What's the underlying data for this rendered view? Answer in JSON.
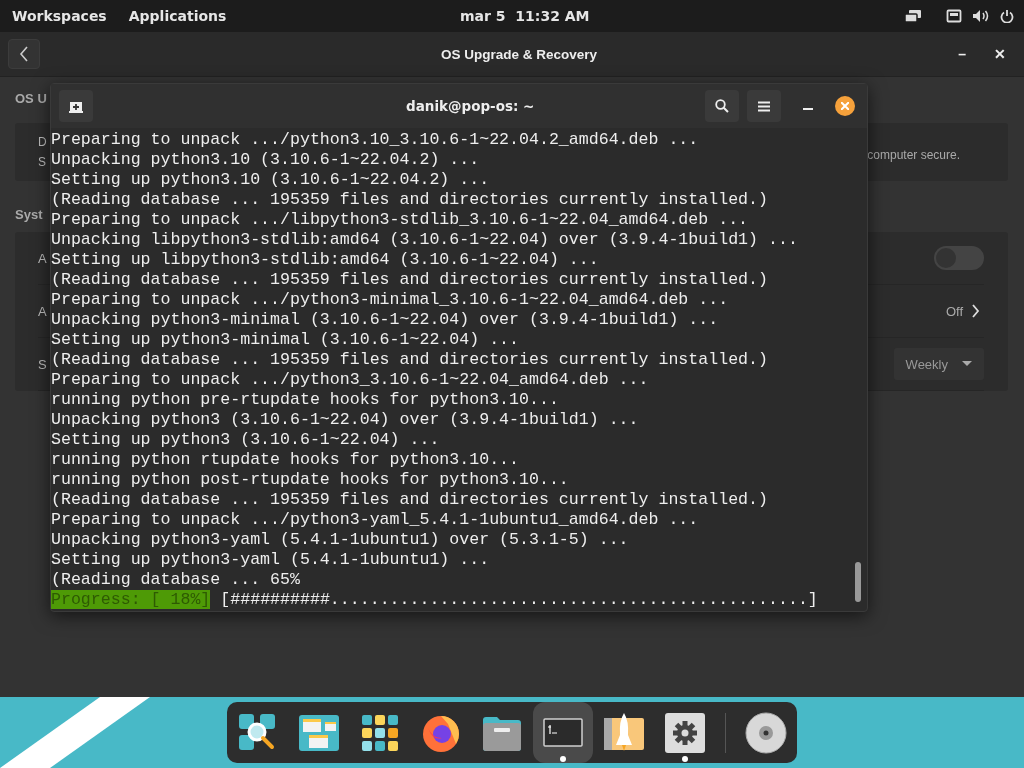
{
  "top_bar": {
    "left": [
      "Workspaces",
      "Applications"
    ],
    "clock": "mar 5  11:32 AM"
  },
  "settings_window": {
    "title": "OS Upgrade & Recovery",
    "minimize": "–",
    "close": "✕",
    "heading": "OS U",
    "card_lines": [
      "D",
      "S"
    ],
    "card_text_right": "computer secure.",
    "section": "Syst",
    "rows": [
      {
        "kind": "toggle",
        "label": "A",
        "on": false
      },
      {
        "kind": "link",
        "label": "A",
        "value": "Off"
      },
      {
        "kind": "dropdown",
        "label": "S",
        "value": "Weekly"
      }
    ]
  },
  "terminal": {
    "title": "danik@pop-os: ~",
    "lines": [
      "Preparing to unpack .../python3.10_3.10.6-1~22.04.2_amd64.deb ...",
      "Unpacking python3.10 (3.10.6-1~22.04.2) ...",
      "Setting up python3.10 (3.10.6-1~22.04.2) ...",
      "(Reading database ... 195359 files and directories currently installed.)",
      "Preparing to unpack .../libpython3-stdlib_3.10.6-1~22.04_amd64.deb ...",
      "Unpacking libpython3-stdlib:amd64 (3.10.6-1~22.04) over (3.9.4-1build1) ...",
      "Setting up libpython3-stdlib:amd64 (3.10.6-1~22.04) ...",
      "(Reading database ... 195359 files and directories currently installed.)",
      "Preparing to unpack .../python3-minimal_3.10.6-1~22.04_amd64.deb ...",
      "Unpacking python3-minimal (3.10.6-1~22.04) over (3.9.4-1build1) ...",
      "Setting up python3-minimal (3.10.6-1~22.04) ...",
      "(Reading database ... 195359 files and directories currently installed.)",
      "Preparing to unpack .../python3_3.10.6-1~22.04_amd64.deb ...",
      "running python pre-rtupdate hooks for python3.10...",
      "Unpacking python3 (3.10.6-1~22.04) over (3.9.4-1build1) ...",
      "Setting up python3 (3.10.6-1~22.04) ...",
      "running python rtupdate hooks for python3.10...",
      "running python post-rtupdate hooks for python3.10...",
      "(Reading database ... 195359 files and directories currently installed.)",
      "Preparing to unpack .../python3-yaml_5.4.1-1ubuntu1_amd64.deb ...",
      "Unpacking python3-yaml (5.4.1-1ubuntu1) over (5.3.1-5) ...",
      "Setting up python3-yaml (5.4.1-1ubuntu1) ...",
      "(Reading database ... 65%"
    ],
    "progress_label": "Progress: [ 18%]",
    "progress_bar": "[##########................................................]"
  },
  "dock": [
    {
      "kind": "search",
      "selected": false,
      "running": false
    },
    {
      "kind": "workspaces",
      "selected": false,
      "running": false
    },
    {
      "kind": "grid",
      "selected": false,
      "running": false
    },
    {
      "kind": "browser",
      "selected": false,
      "running": false
    },
    {
      "kind": "folder",
      "selected": false,
      "running": false
    },
    {
      "kind": "terminal",
      "selected": true,
      "running": true
    },
    {
      "kind": "rocket",
      "selected": false,
      "running": false
    },
    {
      "kind": "gear",
      "selected": false,
      "running": true
    },
    {
      "kind": "separator"
    },
    {
      "kind": "disc",
      "selected": false,
      "running": false
    }
  ]
}
